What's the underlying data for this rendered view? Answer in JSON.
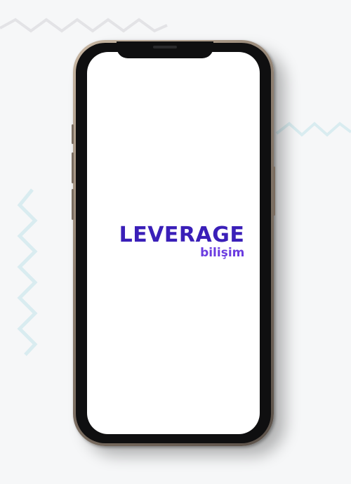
{
  "logo": {
    "main_text": "LEVERAGE",
    "sub_text": "bilişim"
  },
  "colors": {
    "logo_main": "#3a1fb8",
    "logo_sub": "#6b3ce0",
    "screen_background": "#ffffff",
    "page_background": "#f6f7f8"
  },
  "icons": [
    "phone-speaker-icon"
  ]
}
